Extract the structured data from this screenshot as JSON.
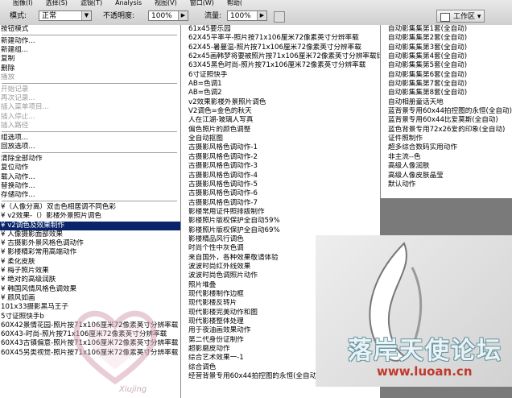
{
  "menubar": [
    "图像(I)",
    "选择(S)",
    "滤镜(T)",
    "Analysis",
    "视图(V)",
    "窗口(W)",
    "帮助(H)"
  ],
  "options": {
    "mode_label": "模式:",
    "mode_value": "正常",
    "opacity_label": "不透明度:",
    "opacity_value": "100%",
    "flow_label": "流量:",
    "flow_value": "100%",
    "workspace": "工作区 ▾"
  },
  "left_panel": [
    {
      "t": "按钮模式",
      "s": "n"
    },
    {
      "sep": true
    },
    {
      "t": "新建动作...",
      "s": "n"
    },
    {
      "t": "新建组...",
      "s": "n"
    },
    {
      "t": "复制",
      "s": "n"
    },
    {
      "t": "删除",
      "s": "n"
    },
    {
      "t": "播放",
      "s": "g"
    },
    {
      "sep": true
    },
    {
      "t": "开始记录",
      "s": "g"
    },
    {
      "t": "再次记录...",
      "s": "g"
    },
    {
      "t": "插入菜单项目...",
      "s": "g"
    },
    {
      "t": "插入停止...",
      "s": "g"
    },
    {
      "t": "插入路径",
      "s": "g"
    },
    {
      "sep": true
    },
    {
      "t": "组选项...",
      "s": "n"
    },
    {
      "t": "回放选项...",
      "s": "n"
    },
    {
      "sep": true
    },
    {
      "t": "清除全部动作",
      "s": "n"
    },
    {
      "t": "复位动作",
      "s": "n"
    },
    {
      "t": "载入动作...",
      "s": "n"
    },
    {
      "t": "替换动作...",
      "s": "n"
    },
    {
      "t": "存储动作...",
      "s": "n"
    },
    {
      "sep": true
    },
    {
      "t": "¥（人像分离）双击色相居调不同色彩",
      "s": "n"
    },
    {
      "t": "¥ v2效果-（）影楼外景照片调色",
      "s": "n"
    },
    {
      "t": "¥ v2调色及效果制作",
      "s": "sel"
    },
    {
      "t": "¥ 人像摄影面部效果",
      "s": "n"
    },
    {
      "t": "¥ 古摄影外景风格色调动作",
      "s": "n"
    },
    {
      "t": "¥ 影楼精彩常用高端动作",
      "s": "n"
    },
    {
      "t": "¥ 柔化皮肤",
      "s": "n"
    },
    {
      "t": "¥ 梅子照片效果",
      "s": "n"
    },
    {
      "t": "¥ 绝对的高级润肤",
      "s": "n"
    },
    {
      "t": "¥ 韩国风情风格色调效果",
      "s": "n"
    },
    {
      "t": "¥ 颜风如画",
      "s": "n"
    },
    {
      "t": "101x33摄影黑马王子",
      "s": "n"
    },
    {
      "t": "5寸证照快手b",
      "s": "n"
    },
    {
      "t": "60X42景情花园-照片按71x106厘米72像素英寸分辨率载",
      "s": "n"
    },
    {
      "t": "60X43-时尚-照片按71x106厘米72像素英寸分辨率载",
      "s": "n"
    },
    {
      "t": "60X43古镇偏意-照片按71x106厘米72像素英寸分辨率载",
      "s": "n"
    },
    {
      "t": "60X45另类视觉-照片按71x106厘米72像素英寸分辨率载",
      "s": "n"
    }
  ],
  "middle_column": [
    "61x45要乐园",
    "62X45平率平-照片按71x106厘米72像素英寸分辨率载",
    "62X45-暑蔓温-照片按71x106厘米72像素英寸分辨率载",
    "62x45画韩梦将要被照片按71x106厘米72像素英寸分辨率载钧",
    "63X45黑色时尚-照片按71x106厘米72像素英寸分辨率载",
    "6寸证照快手",
    "AB=色调1",
    "AB=色调2",
    "v2效果影楼外景照片调色",
    "V2调色=金色的秋天",
    "人在江湖-玻璃人写真",
    "偏色照片的颜色调整",
    "全自动抠图",
    "古摄影风格色调动作-1",
    "古摄影风格色调动作-2",
    "古摄影风格色调动作-3",
    "古摄影风格色调动作-4",
    "古摄影风格色调动作-5",
    "古摄影风格色调动作-6",
    "古摄影风格色调动作-7",
    "影楼常用证件照排版制作",
    "影楼照片版权保护全自动59%",
    "影楼照片版权保护全自动69%",
    "影楼精品风行调色",
    "时尚个性中灰色调",
    "来自国外，各种效果敬请体验",
    "波波时尚红外线效果",
    "波波时尚色调照片动作",
    "照片堆叠",
    "现代影楼制作边框",
    "现代影楼反转片",
    "现代影楼完美动作和图",
    "现代影楼整体处理",
    "用于夜油画效果动作",
    "第二代身份证制作",
    "超影磨皮动作",
    "综合艺术效果一-1",
    "综合调色",
    "经营背景专用60x44拍控图的永恒(全自动)"
  ],
  "right_column": [
    "自动影集集第1套(全自动)",
    "自动影集集第2套(全自动)",
    "自动影集集第3套(全自动)",
    "自动影集集第4套(全自动)",
    "自动影集集第5套(全自动)",
    "自动影集集第6套(全自动)",
    "自动影集集第7套(全自动)",
    "自动影集集第8套(全自动)",
    "自动相册童话天地",
    "蓝背景专用60x44拍控图的永恒(全自动)",
    "蓝背景专用60x44比爱莫斯(全自动)",
    "蓝色背景专用72x26爱的印象(全自动)",
    "证件照制作",
    "超多综合数码实用动作",
    "非主流--色",
    "高级人像润肤",
    "高级人像皮肤晶莹",
    "默认动作"
  ],
  "watermarks": {
    "heart_text": "Xiujing",
    "logo_text": "落岸天使论坛",
    "logo_url": "www.luoan.cn"
  }
}
